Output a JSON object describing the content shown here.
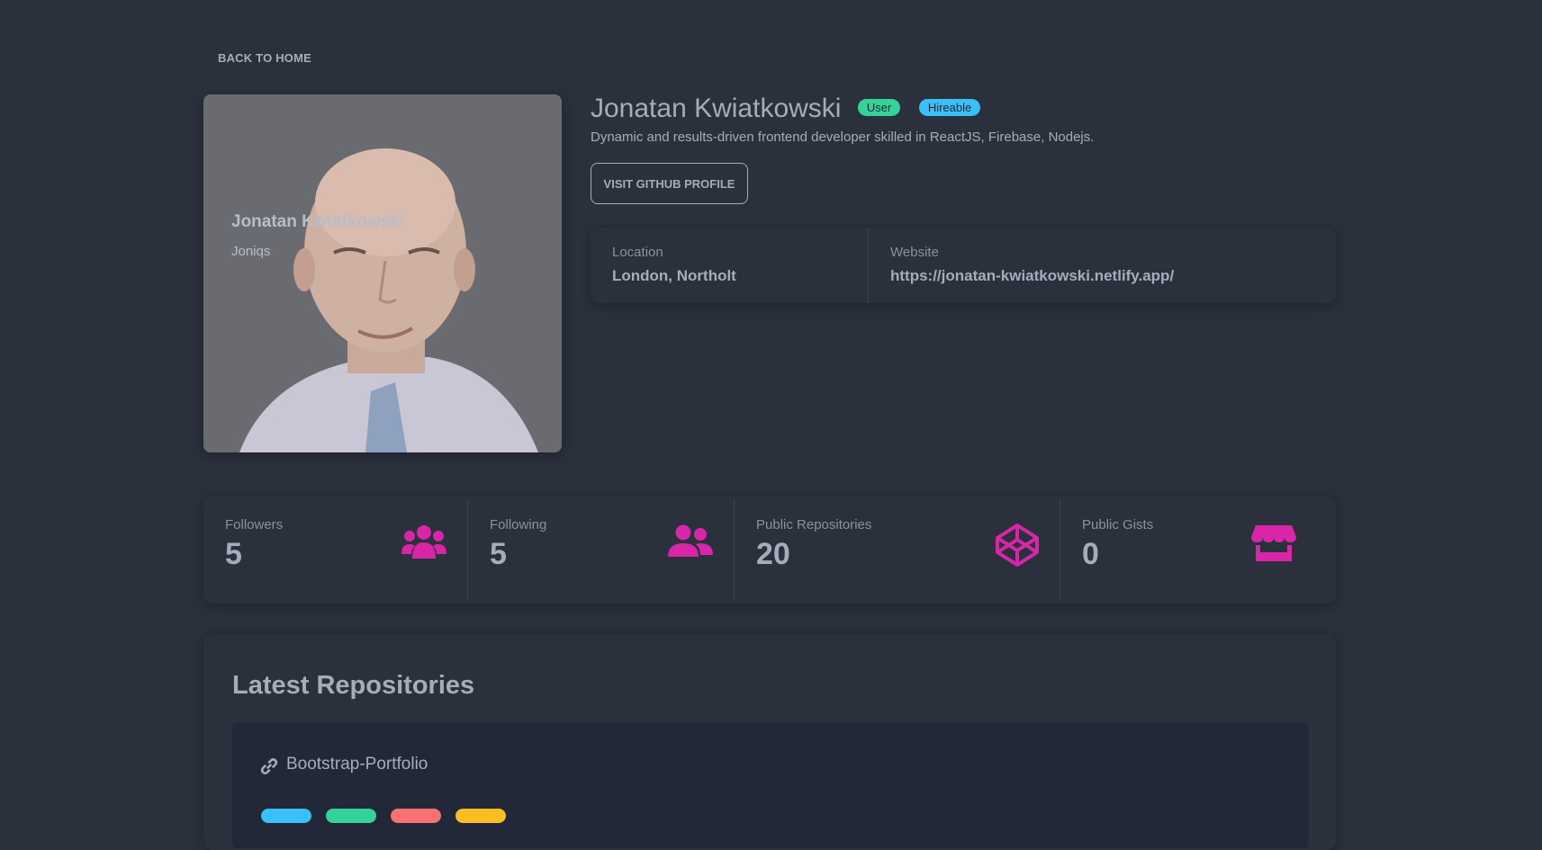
{
  "nav": {
    "back_label": "BACK TO HOME"
  },
  "profile": {
    "name": "Jonatan Kwiatkowski",
    "login": "Joniqs",
    "badges": {
      "user": "User",
      "hireable": "Hireable"
    },
    "bio": "Dynamic and results-driven frontend developer skilled in ReactJS, Firebase, Nodejs.",
    "github_button": "VISIT GITHUB PROFILE",
    "location_label": "Location",
    "location": "London, Northolt",
    "website_label": "Website",
    "website": "https://jonatan-kwiatkowski.netlify.app/"
  },
  "stats": [
    {
      "label": "Followers",
      "value": "5",
      "icon": "users-icon"
    },
    {
      "label": "Following",
      "value": "5",
      "icon": "user-friends-icon"
    },
    {
      "label": "Public Repositories",
      "value": "20",
      "icon": "codepen-icon"
    },
    {
      "label": "Public Gists",
      "value": "0",
      "icon": "store-icon"
    }
  ],
  "repos": {
    "title": "Latest Repositories",
    "items": [
      {
        "name": "Bootstrap-Portfolio"
      }
    ]
  },
  "colors": {
    "background": "#2a303c",
    "accent": "#d926a9",
    "user_badge": "#36d399",
    "hireable_badge": "#3abff8"
  }
}
